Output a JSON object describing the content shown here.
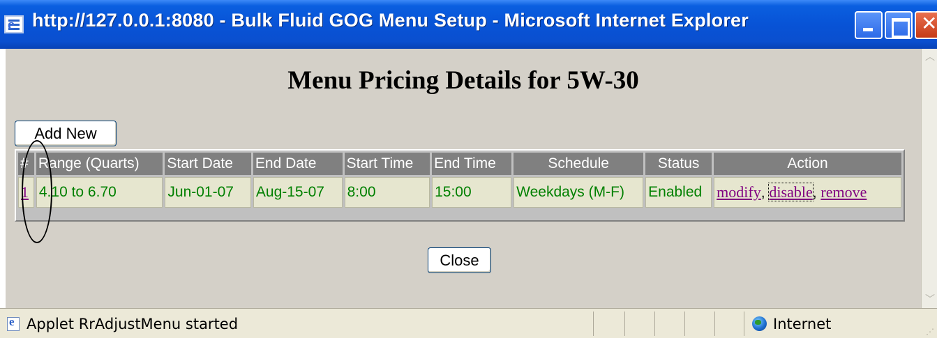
{
  "window": {
    "title": "http://127.0.0.1:8080 - Bulk Fluid GOG Menu Setup - Microsoft Internet Explorer"
  },
  "page": {
    "title": "Menu Pricing Details for 5W-30",
    "add_button": "Add New",
    "close_button": "Close"
  },
  "table": {
    "headers": [
      "#",
      "Range (Quarts)",
      "Start Date",
      "End Date",
      "Start Time",
      "End Time",
      "Schedule",
      "Status",
      "Action"
    ],
    "rows": [
      {
        "num": "1",
        "range": "4.10 to 6.70",
        "start_date": "Jun-01-07",
        "end_date": "Aug-15-07",
        "start_time": "8:00",
        "end_time": "15:00",
        "schedule": "Weekdays (M-F)",
        "status": "Enabled",
        "actions": [
          "modify",
          "disable",
          "remove"
        ],
        "separator": ","
      }
    ]
  },
  "statusbar": {
    "message": "Applet RrAdjustMenu started",
    "zone": "Internet"
  },
  "icons": {
    "title_app": "ie-page-icon",
    "status_page": "ie-page-icon",
    "zone": "internet-globe-icon"
  },
  "colors": {
    "titlebar": "#0a5fe0",
    "header_bg": "#808080",
    "cell_bg": "#e6e6cf",
    "cell_text": "#008000",
    "link": "#800080"
  }
}
